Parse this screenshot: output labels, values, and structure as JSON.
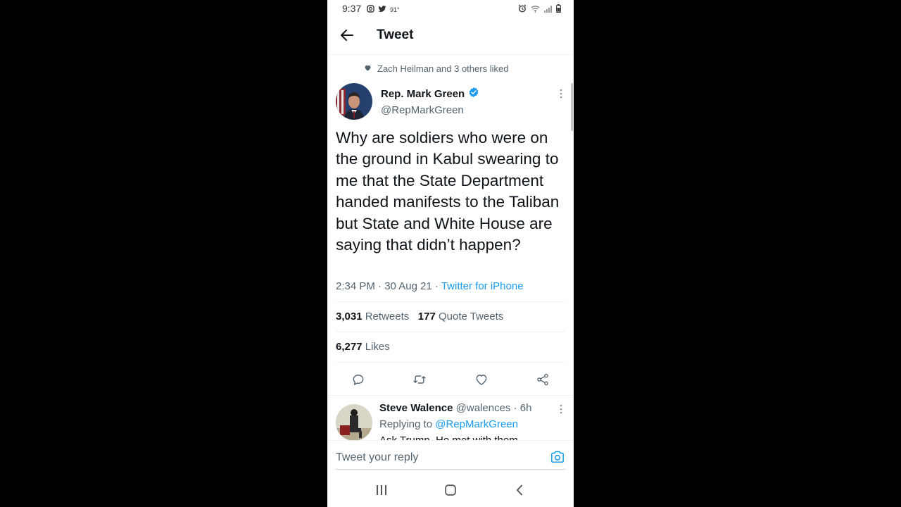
{
  "status_bar": {
    "time": "9:37",
    "temperature": "91°"
  },
  "header": {
    "title": "Tweet"
  },
  "social_context": {
    "text": "Zach Heilman and 3 others liked"
  },
  "author": {
    "name": "Rep. Mark Green",
    "handle": "@RepMarkGreen",
    "verified": true
  },
  "tweet": {
    "text": "Why are soldiers who were on the ground in Kabul swearing to me that the State Department handed manifests to the Taliban but State and White House are saying that didn’t happen?",
    "timestamp": "2:34 PM · 30 Aug 21 · ",
    "source": "Twitter for iPhone"
  },
  "stats": {
    "retweets_count": "3,031",
    "retweets_label": "Retweets",
    "quotes_count": "177",
    "quotes_label": "Quote Tweets",
    "likes_count": "6,277",
    "likes_label": "Likes"
  },
  "actions": [
    "reply-icon",
    "retweet-icon",
    "like-icon",
    "share-icon"
  ],
  "reply": {
    "name": "Steve Walence",
    "handle_time": "@walences · 6h",
    "replying_prefix": "Replying to",
    "replying_to": "@RepMarkGreen",
    "text_partial": "Ask Trump. He met with them"
  },
  "compose": {
    "placeholder": "Tweet your reply"
  },
  "colors": {
    "accent": "#1d9bf0",
    "text": "#0f1419",
    "secondary": "#536471",
    "background": "#000000"
  }
}
